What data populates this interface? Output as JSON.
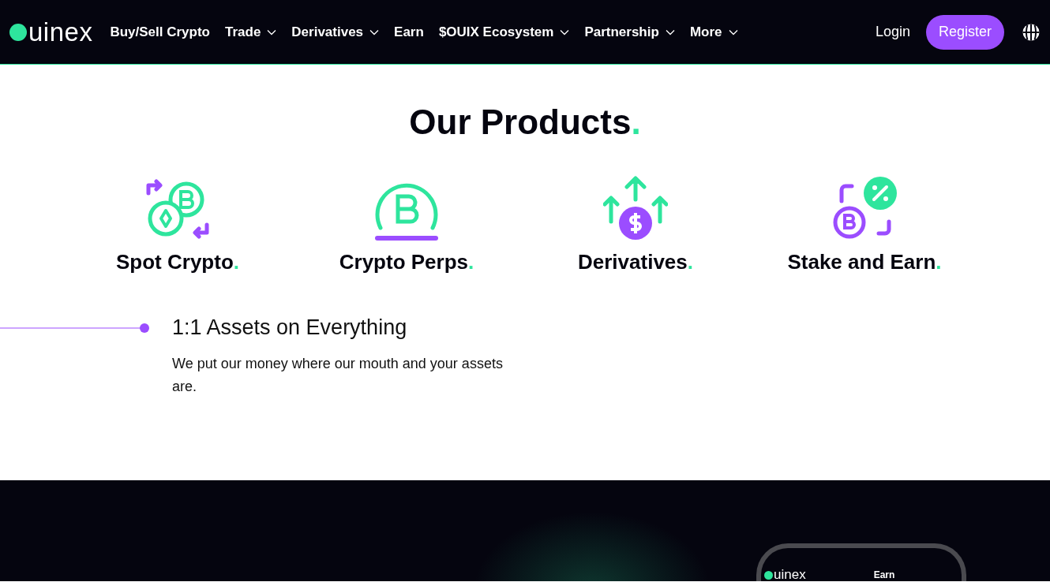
{
  "nav": {
    "logo": "uinex",
    "items": [
      {
        "label": "Buy/Sell Crypto",
        "dropdown": false
      },
      {
        "label": "Trade",
        "dropdown": true
      },
      {
        "label": "Derivatives",
        "dropdown": true
      },
      {
        "label": "Earn",
        "dropdown": false
      },
      {
        "label": "$OUIX Ecosystem",
        "dropdown": true
      },
      {
        "label": "Partnership",
        "dropdown": true
      },
      {
        "label": "More",
        "dropdown": true
      }
    ],
    "login": "Login",
    "register": "Register"
  },
  "products": {
    "title": "Our Products",
    "accent": ".",
    "items": [
      {
        "kind": "swap",
        "label": "Spot Crypto",
        "accent": "."
      },
      {
        "kind": "perps",
        "label": "Crypto Perps",
        "accent": "."
      },
      {
        "kind": "derivatives",
        "label": "Derivatives",
        "accent": "."
      },
      {
        "kind": "stake",
        "label": "Stake and Earn",
        "accent": "."
      }
    ]
  },
  "feature": {
    "heading": "1:1 Assets on Everything",
    "text": "We  put our money where our mouth and your assets are."
  },
  "phone": {
    "logo": "uinex",
    "tab": "Earn"
  }
}
